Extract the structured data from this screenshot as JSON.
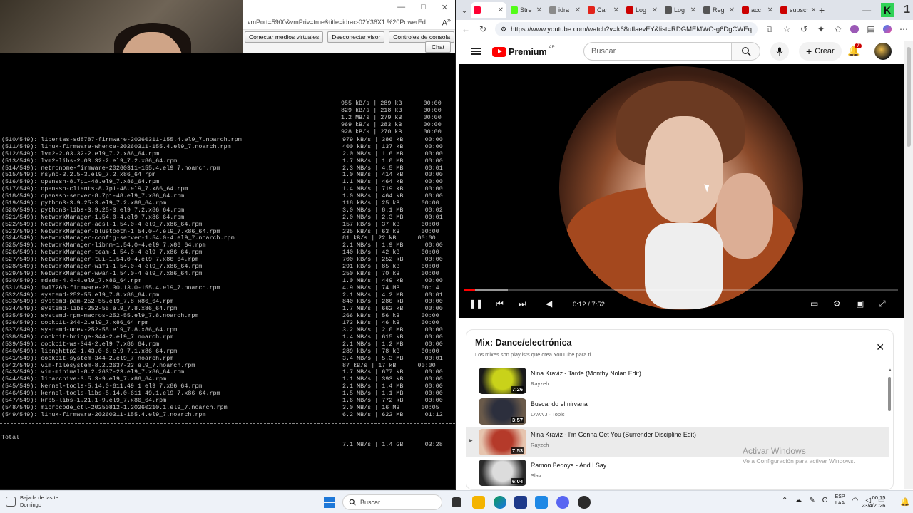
{
  "rdp": {
    "url": "vmPort=5900&vmPriv=true&title=idrac-02Y36X1.%20PowerEd...",
    "win_minimize": "—",
    "win_maximize": "□",
    "win_close": "✕",
    "buttons": [
      "Conectar medios virtuales",
      "Desconectar visor",
      "Controles de consola"
    ],
    "chat": "Chat",
    "reader_icon": "read-aloud-icon"
  },
  "terminal": {
    "top_stats": [
      "955 kB/s | 289 kB      00:00",
      "829 kB/s | 218 kB      00:00",
      "1.2 MB/s | 279 kB      00:00",
      "969 kB/s | 283 kB      00:00",
      "928 kB/s | 270 kB      00:00"
    ],
    "files": [
      {
        "name": "(510/549): libertas-sd8787-firmware-20260311-155.4.el9_7.noarch.rpm",
        "stat": "979 kB/s | 386 kB      00:00"
      },
      {
        "name": "(511/549): linux-firmware-whence-20260311-155.4.el9_7.noarch.rpm",
        "stat": "400 kB/s | 137 kB      00:00"
      },
      {
        "name": "(512/549): lvm2-2.03.32-2.el9_7.2.x86_64.rpm",
        "stat": "2.0 MB/s | 1.6 MB      00:00"
      },
      {
        "name": "(513/549): lvm2-libs-2.03.32-2.el9_7.2.x86_64.rpm",
        "stat": "1.7 MB/s | 1.0 MB      00:00"
      },
      {
        "name": "(514/549): netronome-firmware-20260311-155.4.el9_7.noarch.rpm",
        "stat": "2.3 MB/s | 4.5 MB      00:01"
      },
      {
        "name": "(515/549): rsync-3.2.5-3.el9_7.2.x86_64.rpm",
        "stat": "1.0 MB/s | 414 kB      00:00"
      },
      {
        "name": "(516/549): openssh-8.7p1-48.el9_7.x86_64.rpm",
        "stat": "1.1 MB/s | 464 kB      00:00"
      },
      {
        "name": "(517/549): openssh-clients-8.7p1-48.el9_7.x86_64.rpm",
        "stat": "1.4 MB/s | 719 kB      00:00"
      },
      {
        "name": "(518/549): openssh-server-8.7p1-48.el9_7.x86_64.rpm",
        "stat": "1.0 MB/s | 464 kB      00:00"
      },
      {
        "name": "(519/549): python3-3.9.25-3.el9_7.2.x86_64.rpm",
        "stat": "118 kB/s | 25 kB      00:00"
      },
      {
        "name": "(520/549): python3-libs-3.9.25-3.el9_7.2.x86_64.rpm",
        "stat": "3.0 MB/s | 8.1 MB      00:02"
      },
      {
        "name": "(521/549): NetworkManager-1.54.0-4.el9_7.x86_64.rpm",
        "stat": "2.0 MB/s | 2.3 MB      00:01"
      },
      {
        "name": "(522/549): NetworkManager-adsl-1.54.0-4.el9_7.x86_64.rpm",
        "stat": "157 kB/s | 37 kB      00:00"
      },
      {
        "name": "(523/549): NetworkManager-bluetooth-1.54.0-4.el9_7.x86_64.rpm",
        "stat": "235 kB/s | 63 kB      00:00"
      },
      {
        "name": "(524/549): NetworkManager-config-server-1.54.0-4.el9_7.noarch.rpm",
        "stat": "81 kB/s | 22 kB      00:00"
      },
      {
        "name": "(525/549): NetworkManager-libnm-1.54.0-4.el9_7.x86_64.rpm",
        "stat": "2.1 MB/s | 1.9 MB      00:00"
      },
      {
        "name": "(526/549): NetworkManager-team-1.54.0-4.el9_7.x86_64.rpm",
        "stat": "140 kB/s | 42 kB      00:00"
      },
      {
        "name": "(527/549): NetworkManager-tui-1.54.0-4.el9_7.x86_64.rpm",
        "stat": "700 kB/s | 252 kB      00:00"
      },
      {
        "name": "(528/549): NetworkManager-wifi-1.54.0-4.el9_7.x86_64.rpm",
        "stat": "291 kB/s | 85 kB      00:00"
      },
      {
        "name": "(529/549): NetworkManager-wwan-1.54.0-4.el9_7.x86_64.rpm",
        "stat": "250 kB/s | 70 kB      00:00"
      },
      {
        "name": "(530/549): mdadm-4.4-4.el9_7.x86_64.rpm",
        "stat": "1.0 MB/s | 449 kB      00:00"
      },
      {
        "name": "(531/549): iwl7260-firmware-25.30.13.0-155.4.el9_7.noarch.rpm",
        "stat": "4.9 MB/s | 74 MB      00:14"
      },
      {
        "name": "(532/549): systemd-252-55.el9_7.8.x86_64.rpm",
        "stat": "2.1 MB/s | 4.2 MB      00:01"
      },
      {
        "name": "(533/549): systemd-pam-252-55.el9_7.8.x86_64.rpm",
        "stat": "840 kB/s | 280 kB      00:00"
      },
      {
        "name": "(534/549): systemd-libs-252-55.el9_7.8.x86_64.rpm",
        "stat": "1.7 MB/s | 662 kB      00:00"
      },
      {
        "name": "(535/549): systemd-rpm-macros-252-55.el9_7.8.noarch.rpm",
        "stat": "266 kB/s | 56 kB      00:00"
      },
      {
        "name": "(536/549): cockpit-344-2.el9_7.x86_64.rpm",
        "stat": "173 kB/s | 46 kB      00:00"
      },
      {
        "name": "(537/549): systemd-udev-252-55.el9_7.8.x86_64.rpm",
        "stat": "3.2 MB/s | 2.0 MB      00:00"
      },
      {
        "name": "(538/549): cockpit-bridge-344-2.el9_7.noarch.rpm",
        "stat": "1.4 MB/s | 615 kB      00:00"
      },
      {
        "name": "(539/549): cockpit-ws-344-2.el9_7.x86_64.rpm",
        "stat": "2.1 MB/s | 1.2 MB      00:00"
      },
      {
        "name": "(540/549): libnghttp2-1.43.0-6.el9_7.1.x86_64.rpm",
        "stat": "289 kB/s | 78 kB      00:00"
      },
      {
        "name": "(541/549): cockpit-system-344-2.el9_7.noarch.rpm",
        "stat": "3.4 MB/s | 5.3 MB      00:01"
      },
      {
        "name": "(542/549): vim-filesystem-8.2.2637-23.el9_7.noarch.rpm",
        "stat": "87 kB/s | 17 kB      00:00"
      },
      {
        "name": "(543/549): vim-minimal-8.2.2637-23.el9_7.x86_64.rpm",
        "stat": "1.7 MB/s | 677 kB      00:00"
      },
      {
        "name": "(544/549): libarchive-3.5.3-9.el9_7.x86_64.rpm",
        "stat": "1.1 MB/s | 393 kB      00:00"
      },
      {
        "name": "(545/549): kernel-tools-5.14.0-611.49.1.el9_7.x86_64.rpm",
        "stat": "2.1 MB/s | 1.4 MB      00:00"
      },
      {
        "name": "(546/549): kernel-tools-libs-5.14.0-611.49.1.el9_7.x86_64.rpm",
        "stat": "1.5 MB/s | 1.1 MB      00:00"
      },
      {
        "name": "(547/549): krb5-libs-1.21.1-9.el9_7.x86_64.rpm",
        "stat": "1.6 MB/s | 772 kB      00:00"
      },
      {
        "name": "(548/549): microcode_ctl-20250812-1.20260210.1.el9_7.noarch.rpm",
        "stat": "3.0 MB/s | 16 MB      00:05"
      },
      {
        "name": "(549/549): linux-firmware-20260311-155.4.el9_7.noarch.rpm",
        "stat": "6.2 MB/s | 622 MB      01:12"
      }
    ],
    "total_label": "Total",
    "total_stat": "7.1 MB/s | 1.4 GB      03:28"
  },
  "browser": {
    "tabs": [
      {
        "label": "",
        "icon_color": "#ff0033",
        "active": true
      },
      {
        "label": "Stre",
        "icon_color": "#53fc18"
      },
      {
        "label": "idra",
        "icon_color": "#8a8a8a"
      },
      {
        "label": "Can",
        "icon_color": "#e2231a"
      },
      {
        "label": "Log",
        "icon_color": "#cc0000"
      },
      {
        "label": "Log",
        "icon_color": "#555555"
      },
      {
        "label": "Reg",
        "icon_color": "#555555"
      },
      {
        "label": "acc",
        "icon_color": "#cc0000"
      },
      {
        "label": "subscr",
        "icon_color": "#cc0000"
      }
    ],
    "url": "https://www.youtube.com/watch?v=k68uflaevFY&list=RDGMEMWO-g6DgCWEqKL..."
  },
  "youtube": {
    "logo_text": "Premium",
    "logo_country": "AR",
    "search_placeholder": "Buscar",
    "create_label": "Crear",
    "notif_count": "7",
    "time": "0:12 / 7:52",
    "progress": 0.0254,
    "buffered": 0.1
  },
  "playlist": {
    "title": "Mix: Dance/electrónica",
    "subtitle": "Los mixes son playlists que crea YouTube para ti",
    "items": [
      {
        "name": "Nina Kraviz - Tarde (Monthy Nolan Edit)",
        "artist": "Rayzeh",
        "duration": "7:26",
        "thumb_a": "#c9d21a",
        "thumb_b": "#1a1a1a",
        "current": false
      },
      {
        "name": "Buscando el nirvana",
        "artist": "LAVA J · Topic",
        "duration": "3:57",
        "thumb_a": "#2c2f3d",
        "thumb_b": "#6a5a4a",
        "current": false
      },
      {
        "name": "Nina Kraviz - I'm Gonna Get You (Surrender Discipline Edit)",
        "artist": "Rayzeh",
        "duration": "7:53",
        "thumb_a": "#b53a2a",
        "thumb_b": "#e6c4ae",
        "current": true
      },
      {
        "name": "Ramon Bedoya - And I Say",
        "artist": "Slav",
        "duration": "6:04",
        "thumb_a": "#dcdcdc",
        "thumb_b": "#2a2a2a",
        "current": false
      }
    ],
    "playing_marker": "▶"
  },
  "watermark": {
    "title": "Activar Windows",
    "subtitle": "Ve a Configuración para activar Windows."
  },
  "taskbar": {
    "weather_line1": "Bajada de las te...",
    "weather_line2": "Domingo",
    "search_placeholder": "Buscar",
    "lang_line1": "ESP",
    "lang_line2": "LAA",
    "clock_time": "00:15",
    "clock_date": "23/4/2026"
  }
}
